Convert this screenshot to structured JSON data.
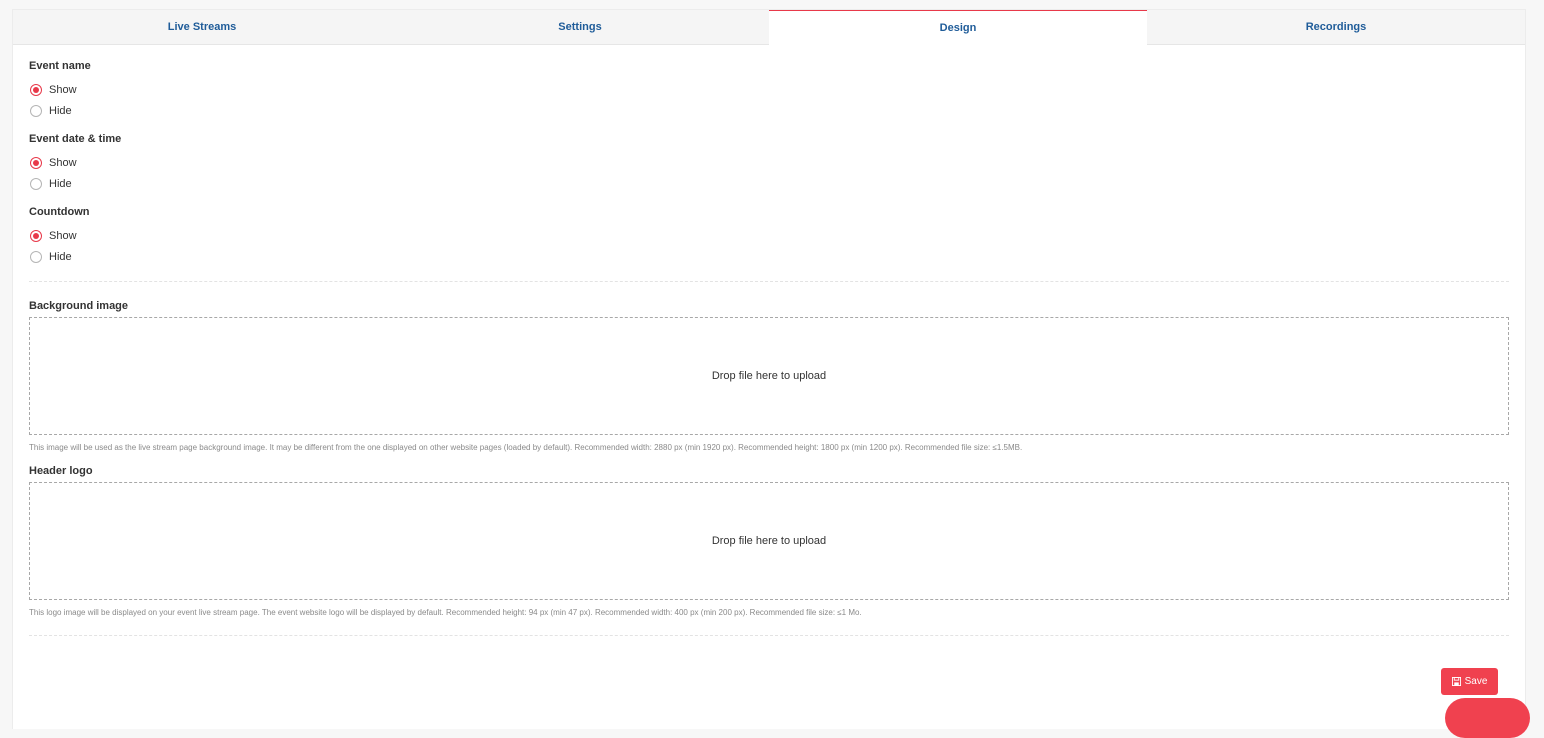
{
  "tabs": [
    {
      "label": "Live Streams",
      "active": false
    },
    {
      "label": "Settings",
      "active": false
    },
    {
      "label": "Design",
      "active": true
    },
    {
      "label": "Recordings",
      "active": false
    }
  ],
  "event_name": {
    "label": "Event name",
    "options": [
      "Show",
      "Hide"
    ],
    "selected": "Show"
  },
  "event_date_time": {
    "label": "Event date & time",
    "options": [
      "Show",
      "Hide"
    ],
    "selected": "Show"
  },
  "countdown": {
    "label": "Countdown",
    "options": [
      "Show",
      "Hide"
    ],
    "selected": "Show"
  },
  "background_image": {
    "label": "Background image",
    "dropzone_text": "Drop file here to upload",
    "help": "This image will be used as the live stream page background image. It may be different from the one displayed on other website pages (loaded by default). Recommended width: 2880 px (min 1920 px). Recommended height: 1800 px (min 1200 px). Recommended file size: ≤1.5MB."
  },
  "header_logo": {
    "label": "Header logo",
    "dropzone_text": "Drop file here to upload",
    "help": "This logo image will be displayed on your event live stream page. The event website logo will be displayed by default. Recommended height: 94 px (min 47 px). Recommended width: 400 px (min 200 px). Recommended file size: ≤1 Mo."
  },
  "save": {
    "label": "Save",
    "icon": "floppy-disk-icon"
  },
  "colors": {
    "accent": "#e8394a",
    "tab_text": "#1f5c99"
  }
}
